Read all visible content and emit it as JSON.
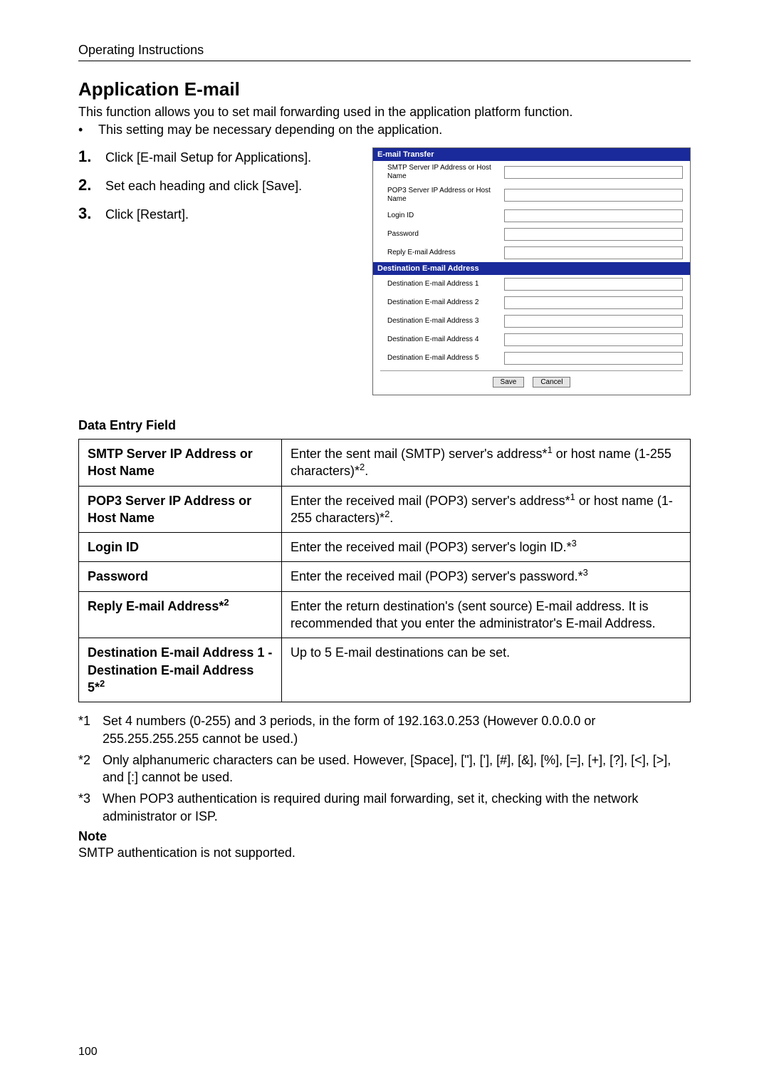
{
  "running_header": "Operating Instructions",
  "title": "Application E-mail",
  "intro": "This function allows you to set mail forwarding used in the application platform function.",
  "intro_bullet": "This setting may be necessary depending on the application.",
  "steps": [
    {
      "num": "1.",
      "text": "Click [E-mail Setup for Applications]."
    },
    {
      "num": "2.",
      "text": "Set each heading and click [Save]."
    },
    {
      "num": "3.",
      "text": "Click [Restart]."
    }
  ],
  "form": {
    "header1": "E-mail Transfer",
    "transfer_fields": [
      "SMTP Server IP Address or Host Name",
      "POP3 Server IP Address or Host Name",
      "Login ID",
      "Password",
      "Reply E-mail Address"
    ],
    "header2": "Destination E-mail Address",
    "dest_fields": [
      "Destination E-mail Address 1",
      "Destination E-mail Address 2",
      "Destination E-mail Address 3",
      "Destination E-mail Address 4",
      "Destination E-mail Address 5"
    ],
    "save": "Save",
    "cancel": "Cancel"
  },
  "table_heading": "Data Entry Field",
  "table": [
    {
      "label_pre": "SMTP Server IP Address or Host Name",
      "label_sup": "",
      "desc_pre": "Enter the sent mail (SMTP) server's address*",
      "desc_sup1": "1",
      "desc_mid": " or host name (1-255 characters)*",
      "desc_sup2": "2",
      "desc_post": "."
    },
    {
      "label_pre": "POP3 Server IP Address or Host Name",
      "label_sup": "",
      "desc_pre": "Enter the received mail (POP3) server's address*",
      "desc_sup1": "1",
      "desc_mid": " or host name (1-255 characters)*",
      "desc_sup2": "2",
      "desc_post": "."
    },
    {
      "label_pre": "Login ID",
      "label_sup": "",
      "desc_pre": "Enter the received mail (POP3) server's login ID.*",
      "desc_sup1": "3",
      "desc_mid": "",
      "desc_sup2": "",
      "desc_post": ""
    },
    {
      "label_pre": "Password",
      "label_sup": "",
      "desc_pre": "Enter the received mail (POP3) server's password.*",
      "desc_sup1": "3",
      "desc_mid": "",
      "desc_sup2": "",
      "desc_post": ""
    },
    {
      "label_pre": "Reply E-mail Address*",
      "label_sup": "2",
      "desc_pre": "Enter the return destination's (sent source) E-mail address. It is recommended that you enter the administrator's E-mail Address.",
      "desc_sup1": "",
      "desc_mid": "",
      "desc_sup2": "",
      "desc_post": ""
    },
    {
      "label_pre": "Destination E-mail Address 1 - Destination E-mail Address 5*",
      "label_sup": "2",
      "desc_pre": "Up to 5 E-mail destinations can be set.",
      "desc_sup1": "",
      "desc_mid": "",
      "desc_sup2": "",
      "desc_post": ""
    }
  ],
  "footnotes": [
    {
      "mark": "*1",
      "text": "Set 4 numbers (0-255) and 3 periods, in the form of 192.163.0.253 (However 0.0.0.0 or 255.255.255.255 cannot be used.)"
    },
    {
      "mark": "*2",
      "text": "Only alphanumeric characters can be used. However, [Space], [\"], ['], [#], [&], [%], [=], [+], [?], [<], [>], and [:] cannot be used."
    },
    {
      "mark": "*3",
      "text": "When POP3 authentication is required during mail forwarding, set it, checking with the network administrator or ISP."
    }
  ],
  "note_head": "Note",
  "note_body": "SMTP authentication is not supported.",
  "page_number": "100"
}
